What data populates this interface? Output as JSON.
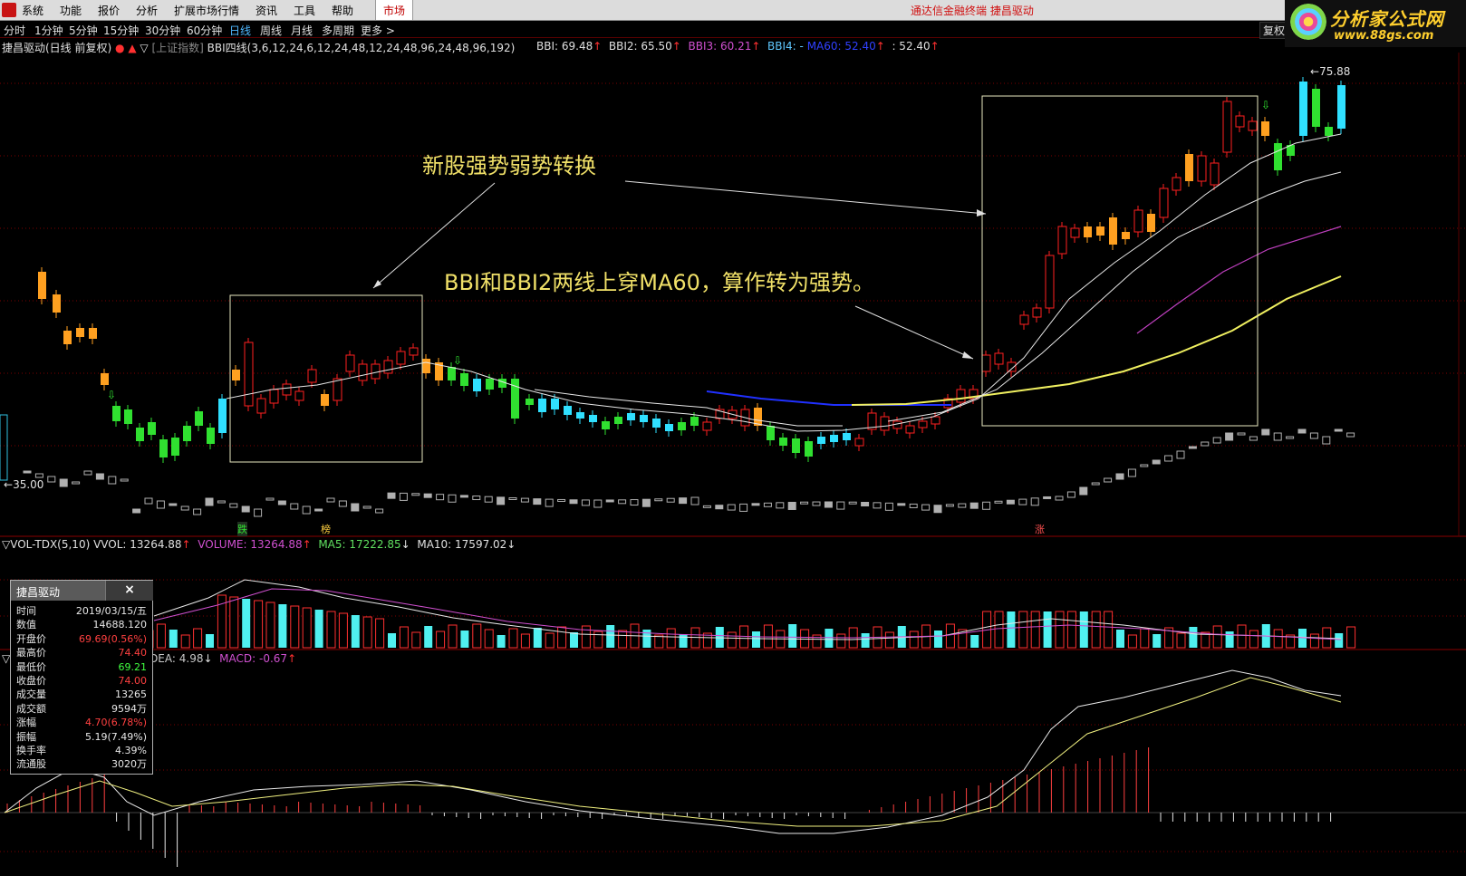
{
  "menu": {
    "items": [
      "系统",
      "功能",
      "报价",
      "分析",
      "扩展市场行情",
      "资讯",
      "工具",
      "帮助"
    ],
    "market_tab": "市场",
    "app_title": "通达信金融终端  捷昌驱动"
  },
  "period_bar": {
    "items": [
      "分时",
      "1分钟",
      "5分钟",
      "15分钟",
      "30分钟",
      "60分钟",
      "日线",
      "周线",
      "月线",
      "多周期",
      "更多 >"
    ],
    "active": "日线",
    "right_button": "复权"
  },
  "brand": {
    "name": "分析家公式网",
    "url": "www.88gs.com"
  },
  "main_header": {
    "stock": "捷昌驱动(日线 前复权)",
    "overlay": "上证指数",
    "indicator": "BBI四线(3,6,12,24,6,12,24,48,12,24,48,96,24,48,96,192)",
    "values": [
      {
        "label": "BBI: 69.48",
        "arrow": "↑",
        "color": "#e0e0e0"
      },
      {
        "label": "BBI2: 65.50",
        "arrow": "↑",
        "color": "#e0e0e0"
      },
      {
        "label": "BBI3: 60.21",
        "arrow": "↑",
        "color": "#d050d0"
      },
      {
        "label": "BBI4: -",
        "arrow": "",
        "color": "#60c8ff"
      },
      {
        "label": "MA60: 52.40",
        "arrow": "↑",
        "color": "#3040ff"
      },
      {
        "label": ": 52.40",
        "arrow": "↑",
        "color": "#e0e0e0"
      }
    ],
    "high_label": "75.88",
    "low_label": "35.00"
  },
  "annotations": {
    "title_text": "新股强势弱势转换",
    "note_text": "BBI和BBI2两线上穿MA60，算作转为强势。"
  },
  "markers": {
    "die": "跌",
    "bang": "榜",
    "zhang": "涨"
  },
  "vol_header": {
    "name": "VOL-TDX(5,10)",
    "vvol": "VVOL: 13264.88",
    "volume": "VOLUME: 13264.88",
    "ma5": "MA5: 17222.85",
    "ma10": "MA10: 17597.02"
  },
  "macd_header": {
    "dea": "DEA: 4.98",
    "macd": "MACD: -0.67"
  },
  "popup": {
    "title": "捷昌驱动",
    "close": "×",
    "rows": [
      {
        "k": "时间",
        "v": "2019/03/15/五",
        "c": "#e6e6e6"
      },
      {
        "k": "数值",
        "v": "14688.120",
        "c": "#e6e6e6"
      },
      {
        "k": "开盘价",
        "v": "69.69(0.56%)",
        "c": "#ff4040"
      },
      {
        "k": "最高价",
        "v": "74.40",
        "c": "#ff4040"
      },
      {
        "k": "最低价",
        "v": "69.21",
        "c": "#40ff40"
      },
      {
        "k": "收盘价",
        "v": "74.00",
        "c": "#ff4040"
      },
      {
        "k": "成交量",
        "v": "13265",
        "c": "#e6e6e6"
      },
      {
        "k": "成交额",
        "v": "9594万",
        "c": "#e6e6e6"
      },
      {
        "k": "涨幅",
        "v": "4.70(6.78%)",
        "c": "#ff4040"
      },
      {
        "k": "振幅",
        "v": "5.19(7.49%)",
        "c": "#e6e6e6"
      },
      {
        "k": "换手率",
        "v": "4.39%",
        "c": "#e6e6e6"
      },
      {
        "k": "流通股",
        "v": "3020万",
        "c": "#e6e6e6"
      }
    ]
  },
  "colors": {
    "up": "#ff2020",
    "down": "#20e0ff",
    "green": "#30e030",
    "orange": "#ffa020",
    "bbi": "#e8e8e8",
    "bbi3": "#c040c0",
    "ma60": "#2030ff",
    "yellow_line": "#f0f060"
  }
}
